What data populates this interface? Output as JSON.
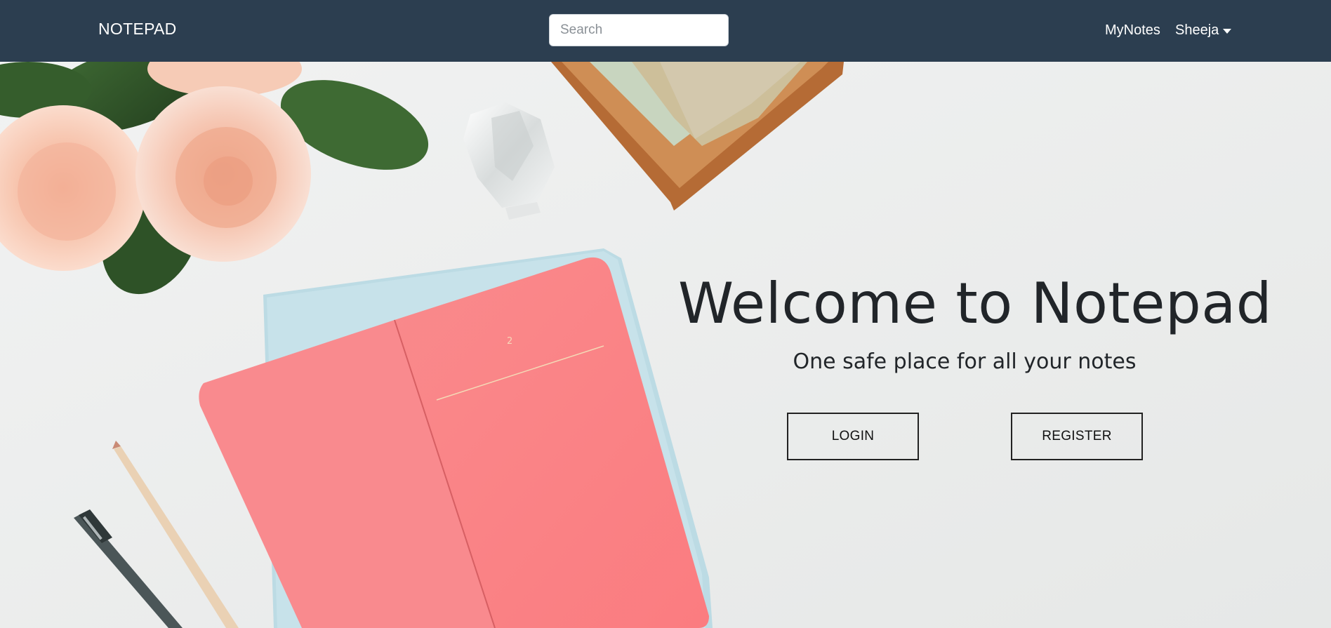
{
  "navbar": {
    "brand": "NOTEPAD",
    "search_placeholder": "Search",
    "links": {
      "mynotes": "MyNotes",
      "user": "Sheeja"
    },
    "background_color": "#2c3e50"
  },
  "hero": {
    "title": "Welcome to Notepad",
    "subtitle": "One safe place for all your notes",
    "login_label": "LOGIN",
    "register_label": "REGISTER",
    "notebook_page_number": "2"
  },
  "icons": {
    "user_menu": "caret-down-icon"
  }
}
